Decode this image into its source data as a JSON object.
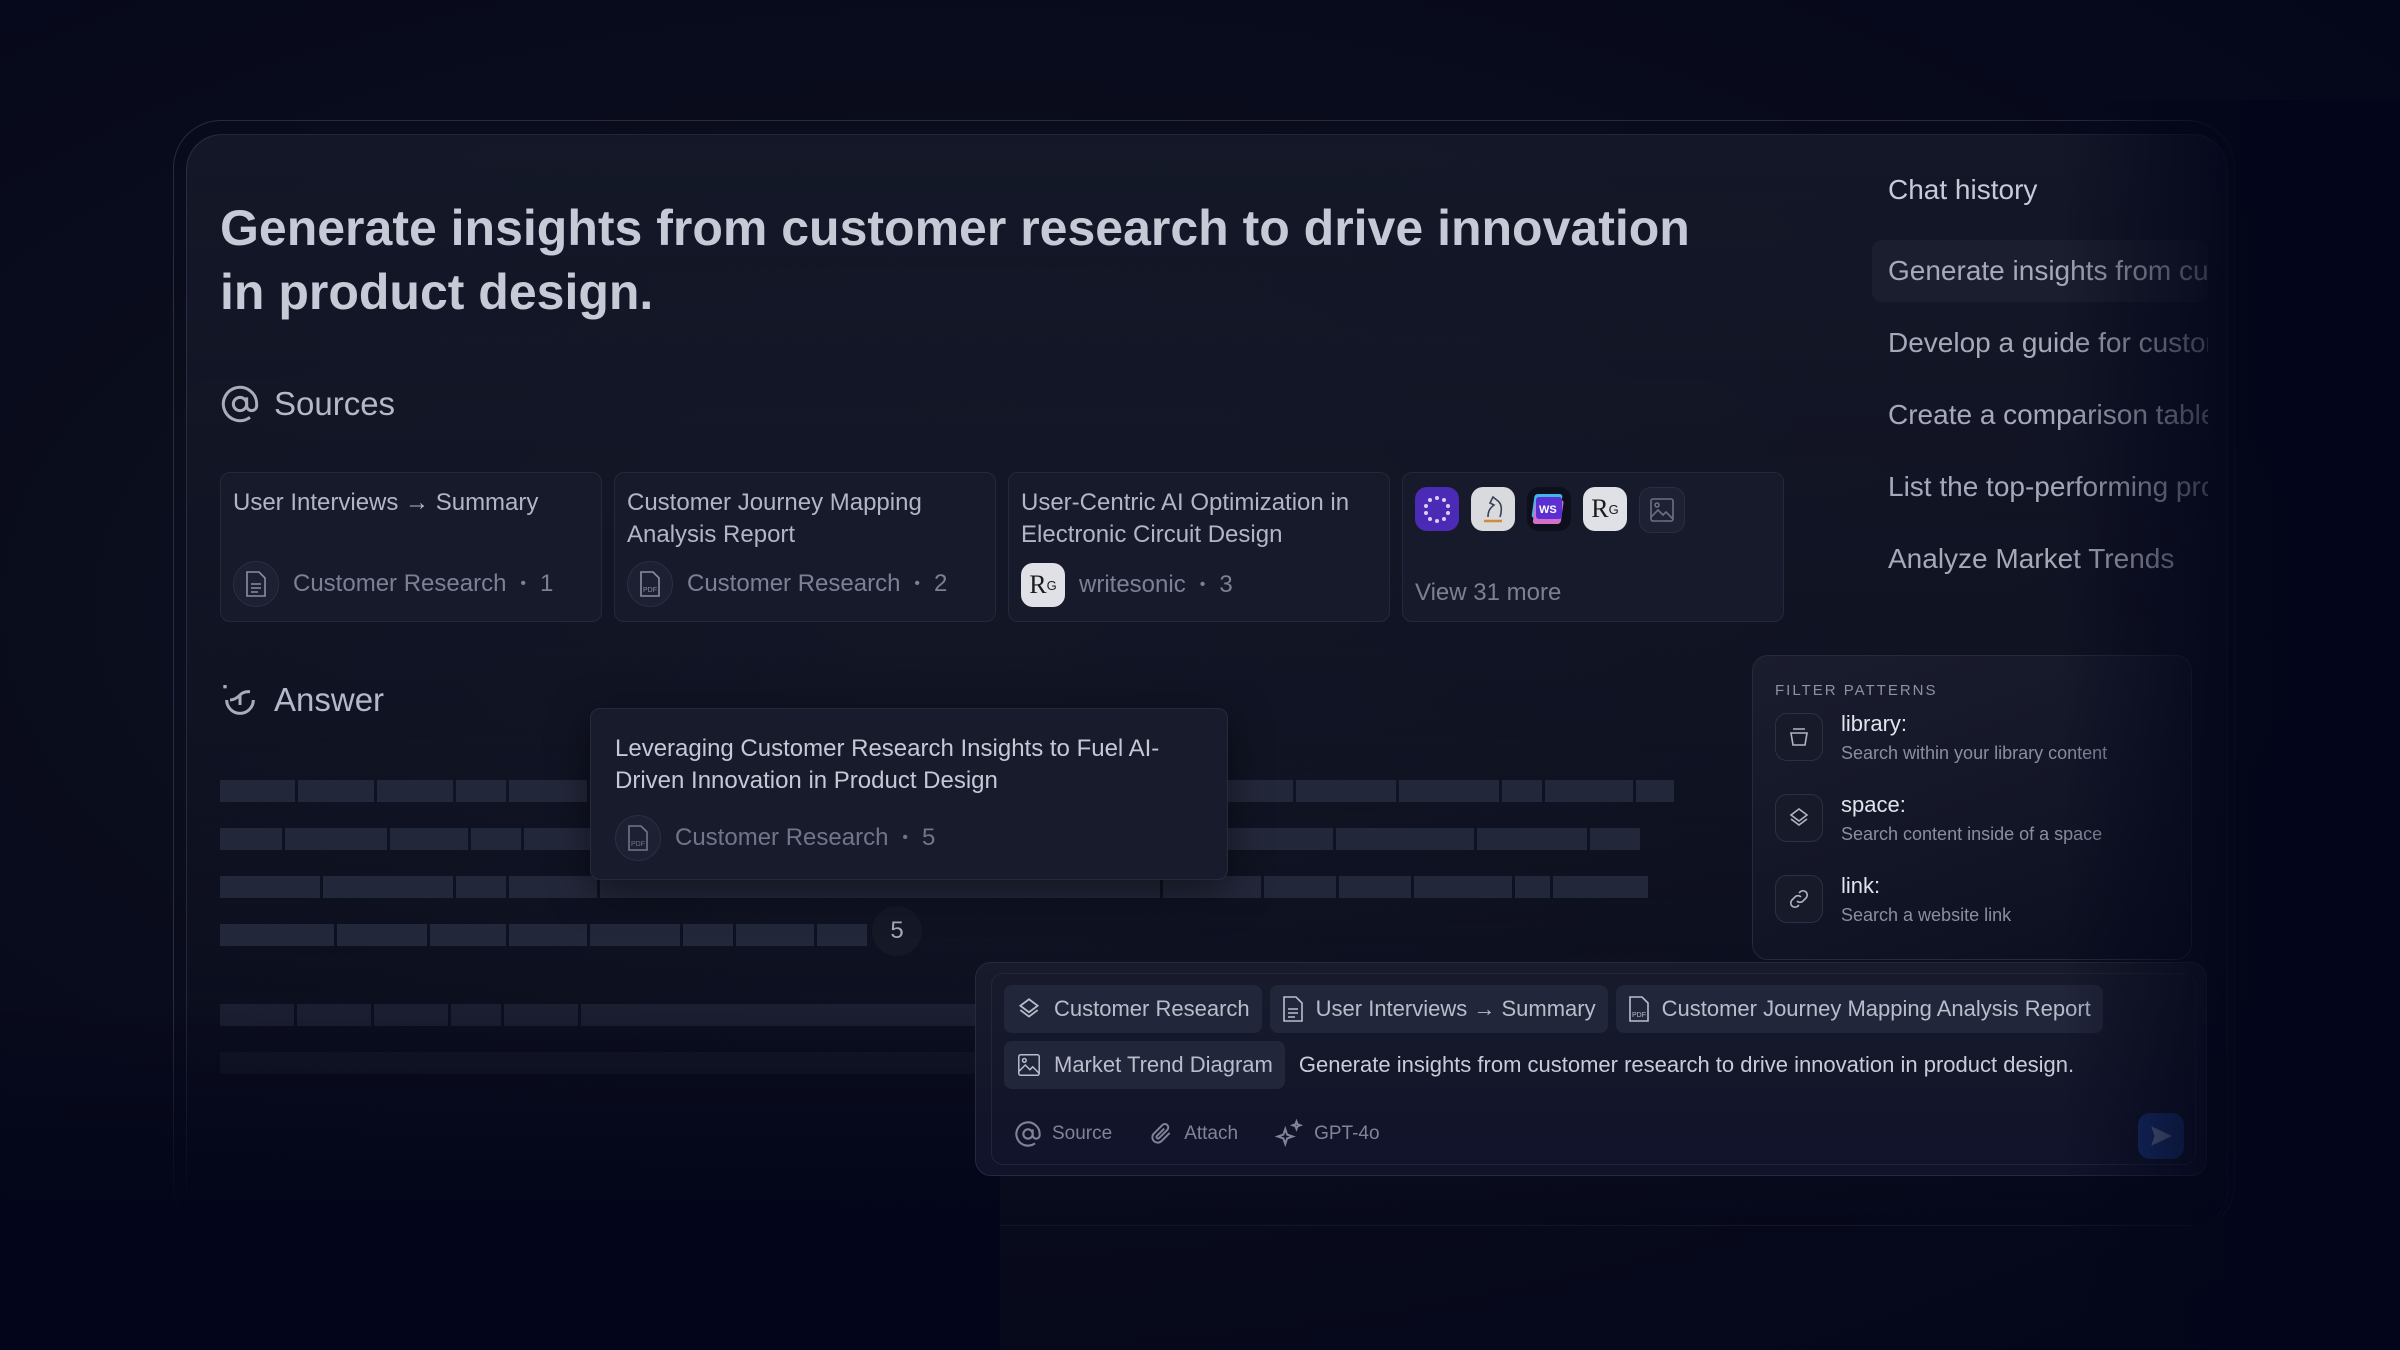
{
  "query_title": "Generate insights from customer research to drive innovation in product design.",
  "sources": {
    "heading": "Sources",
    "cards": [
      {
        "title": "User Interviews → Summary",
        "meta": "Customer Research",
        "index": "1",
        "icon": "doc-icon"
      },
      {
        "title": "Customer Journey Mapping Analysis Report",
        "meta": "Customer Research",
        "index": "2",
        "icon": "pdf-icon"
      },
      {
        "title": "User-Centric AI Optimization in Electronic Circuit Design",
        "meta": "writesonic",
        "index": "3",
        "icon": "researchgate-logo"
      }
    ],
    "more": {
      "logos": [
        "purple-dots-logo",
        "horse-logo",
        "writesonic-logo",
        "researchgate-logo",
        "image-icon"
      ],
      "ws_text": "WS",
      "rg_text": "R",
      "rg_sup": "G",
      "label": "View 31 more"
    }
  },
  "answer": {
    "heading": "Answer",
    "citation_badge": "5"
  },
  "tooltip": {
    "title": "Leveraging Customer Research Insights to Fuel AI-Driven Innovation in Product Design",
    "meta": "Customer Research",
    "index": "5"
  },
  "chat_history": {
    "title": "Chat history",
    "items": [
      "Generate insights from customer research",
      "Develop a guide for customer onboarding",
      "Create a comparison table",
      "List the top-performing products",
      "Analyze Market Trends"
    ]
  },
  "filter_patterns": {
    "label": "FILTER PATTERNS",
    "items": [
      {
        "name": "library:",
        "desc": "Search within your library content",
        "icon": "library-icon"
      },
      {
        "name": "space:",
        "desc": "Search content inside of a space",
        "icon": "layers-icon"
      },
      {
        "name": "link:",
        "desc": "Search a website link",
        "icon": "link-icon"
      }
    ]
  },
  "composer": {
    "chips": [
      {
        "label": "Customer Research",
        "icon": "layers-icon"
      },
      {
        "label": "User Interviews → Summary",
        "icon": "doc-icon"
      },
      {
        "label": "Customer Journey Mapping Analysis Report",
        "icon": "pdf-icon"
      },
      {
        "label": "Market Trend Diagram",
        "icon": "image-icon"
      }
    ],
    "prompt": "Generate insights from customer research to drive innovation in product design.",
    "tools": {
      "source": "Source",
      "attach": "Attach",
      "model": "GPT-4o"
    },
    "send_color": "#16306b"
  },
  "colors": {
    "background": "#03051a",
    "panel": "#171a2a",
    "accent": "#4b2bb5"
  }
}
